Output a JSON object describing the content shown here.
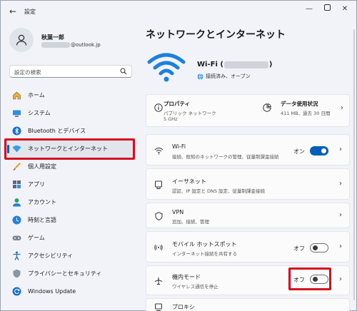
{
  "app": {
    "title": "設定"
  },
  "profile": {
    "name": "秋葉一郎",
    "email_suffix": "@outlook.jp"
  },
  "search": {
    "placeholder": "設定の検索"
  },
  "sidebar": {
    "items": [
      {
        "label": "ホーム",
        "icon": "home-icon"
      },
      {
        "label": "システム",
        "icon": "system-icon"
      },
      {
        "label": "Bluetooth とデバイス",
        "icon": "bluetooth-icon"
      },
      {
        "label": "ネットワークとインターネット",
        "icon": "network-icon"
      },
      {
        "label": "個人用設定",
        "icon": "brush-icon"
      },
      {
        "label": "アプリ",
        "icon": "apps-icon"
      },
      {
        "label": "アカウント",
        "icon": "account-icon"
      },
      {
        "label": "時刻と言語",
        "icon": "time-language-icon"
      },
      {
        "label": "ゲーム",
        "icon": "gaming-icon"
      },
      {
        "label": "アクセシビリティ",
        "icon": "accessibility-icon"
      },
      {
        "label": "プライバシーとセキュリティ",
        "icon": "shield-icon"
      },
      {
        "label": "Windows Update",
        "icon": "update-icon"
      }
    ],
    "selected": "ネットワークとインターネット"
  },
  "main": {
    "title": "ネットワークとインターネット",
    "wifi": {
      "name_prefix": "Wi-Fi (",
      "name_suffix": ")",
      "status": "接続済み、オープン"
    },
    "properties": {
      "title": "プロパティ",
      "line1": "パブリック ネットワーク",
      "line2": "5 GHz"
    },
    "data_usage": {
      "title": "データ使用状況",
      "detail": "411 MB、過去 30 日間"
    },
    "rows": [
      {
        "title": "Wi-Fi",
        "subtitle": "接続、既知のネットワークの管理、従量制課金接続",
        "toggle": "オン",
        "toggle_on": true,
        "icon": "wifi-icon"
      },
      {
        "title": "イーサネット",
        "subtitle": "認証、IP 設定と DNS 設定、従量制課金接続",
        "icon": "ethernet-icon"
      },
      {
        "title": "VPN",
        "subtitle": "追加、接続、管理",
        "icon": "vpn-icon"
      },
      {
        "title": "モバイル ホットスポット",
        "subtitle": "インターネット接続を共有する",
        "toggle": "オフ",
        "toggle_on": false,
        "icon": "hotspot-icon"
      },
      {
        "title": "機内モード",
        "subtitle": "ワイヤレス通信を停止",
        "toggle": "オフ",
        "toggle_on": false,
        "icon": "airplane-icon"
      },
      {
        "title": "プロキシ",
        "subtitle": "",
        "icon": "proxy-icon"
      }
    ]
  },
  "colors": {
    "accent": "#005fb8",
    "highlight_box": "#d50f1e"
  }
}
